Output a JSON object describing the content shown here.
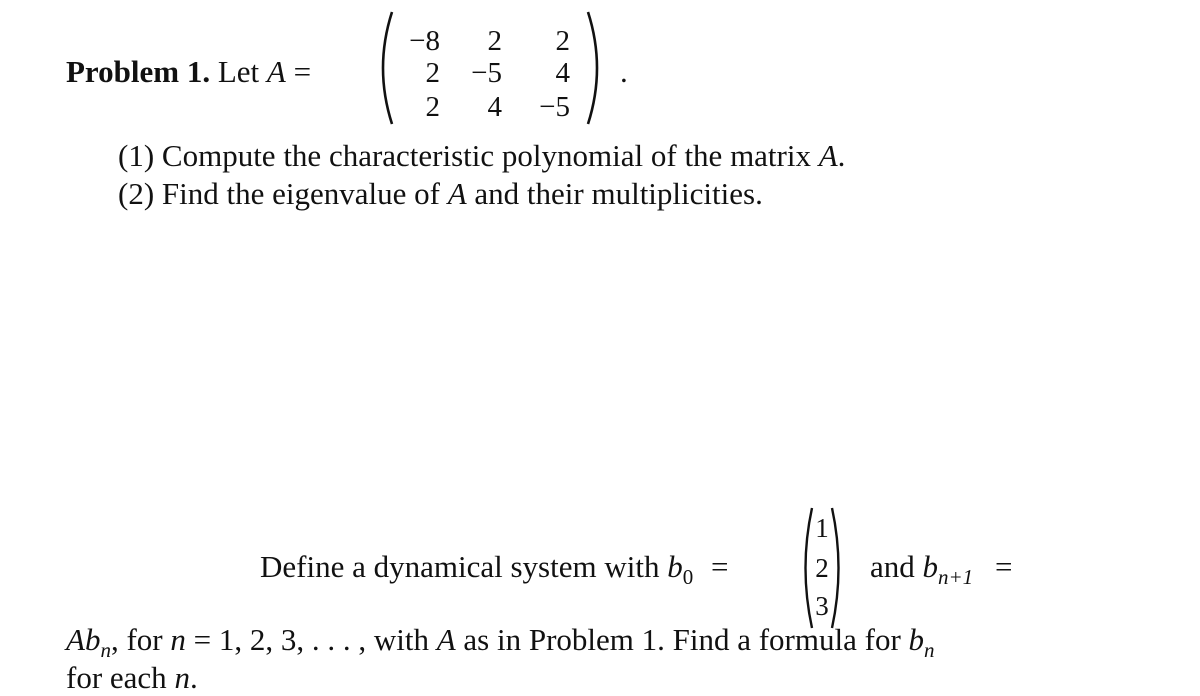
{
  "problem1": {
    "label": "Problem 1.",
    "let_text": "Let",
    "matrix_name": "A",
    "equals": "=",
    "matrix": [
      [
        "−8",
        "2",
        "2"
      ],
      [
        "2",
        "−5",
        "4"
      ],
      [
        "2",
        "4",
        "−5"
      ]
    ],
    "trailing": ".",
    "items": [
      {
        "number": "(1)",
        "text_before": "Compute the characteristic polynomial of the matrix",
        "var": "A",
        "text_after": "."
      },
      {
        "number": "(2)",
        "text_before": "Find the eigenvalue of",
        "var": "A",
        "text_after": "and their multiplicities."
      }
    ]
  },
  "dynamical_system": {
    "intro": "Define a dynamical system with",
    "b_var": "b",
    "b0_sub": "0",
    "equals": "=",
    "b0_vector": [
      "1",
      "2",
      "3"
    ],
    "and_text": "and",
    "bn1_sub": "n+1",
    "equals2": "=",
    "line3_A": "A",
    "line3_b": "b",
    "line3_sub": "n",
    "line3_mid1": ", for",
    "line3_n": "n",
    "line3_mid2": "= 1, 2, 3, . . . , with",
    "line3_A2": "A",
    "line3_mid3": "as in Problem 1. Find a formula for",
    "line3_b2": "b",
    "line3_sub2": "n",
    "line4_text": "for each",
    "line4_n": "n",
    "line4_end": "."
  }
}
